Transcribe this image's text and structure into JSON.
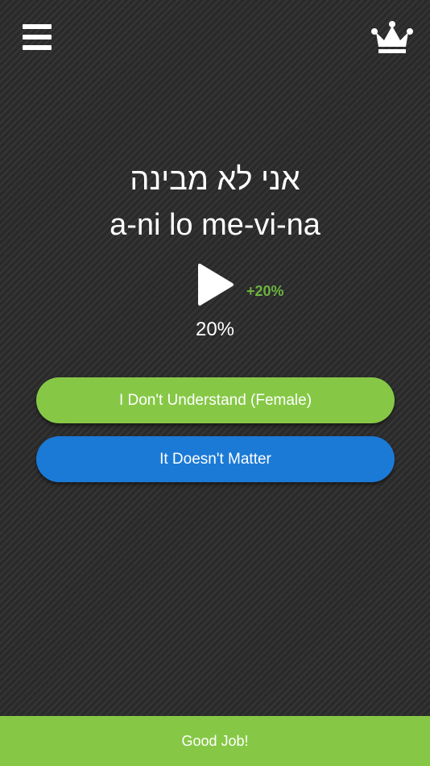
{
  "header": {
    "menu_icon": "hamburger-menu-icon",
    "crown_icon": "crown-icon"
  },
  "lesson": {
    "hebrew": "אני לא מבינה",
    "transliteration": "a-ni lo me-vi-na",
    "play_icon": "play-icon",
    "bonus": "+20%",
    "progress": "20%"
  },
  "answers": [
    {
      "label": "I Don't Understand (Female)",
      "color": "#86c846"
    },
    {
      "label": "It Doesn't Matter",
      "color": "#1b7ad6"
    }
  ],
  "footer": {
    "label": "Good Job!",
    "color": "#86c846"
  },
  "colors": {
    "background": "#2b2b2b",
    "bonus_text": "#6db33f"
  }
}
